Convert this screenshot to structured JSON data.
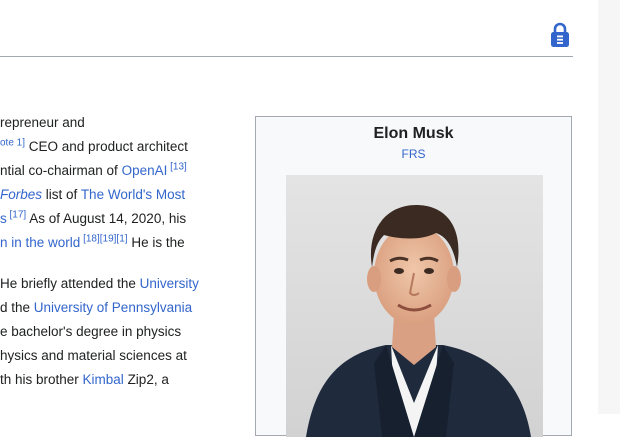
{
  "article": {
    "lines": [
      {
        "parts": [
          {
            "t": "repreneur and",
            "link": false
          }
        ]
      },
      {
        "parts": [
          {
            "t": "ote 1]",
            "cite": true
          },
          {
            "t": " CEO and product architect",
            "link": false
          }
        ]
      },
      {
        "parts": [
          {
            "t": "ntial co-chairman of ",
            "link": false
          },
          {
            "t": "OpenAI",
            "link": true
          },
          {
            "t": " [13]",
            "cite": true
          }
        ]
      },
      {
        "parts": [
          {
            "t": "Forbes",
            "link": true,
            "italic": true
          },
          {
            "t": " list of ",
            "link": false
          },
          {
            "t": "The World's Most",
            "link": true
          }
        ]
      },
      {
        "parts": [
          {
            "t": "s",
            "link": true
          },
          {
            "t": " [17]",
            "cite": true
          },
          {
            "t": " As of August 14, 2020, his",
            "link": false
          }
        ]
      },
      {
        "parts": [
          {
            "t": "n in the world",
            "link": true
          },
          {
            "t": " [18][19][1]",
            "cite": true
          },
          {
            "t": " He is the",
            "link": false
          }
        ]
      },
      {
        "gap": true
      },
      {
        "parts": [
          {
            "t": "He briefly attended the ",
            "link": false
          },
          {
            "t": "University",
            "link": true
          }
        ]
      },
      {
        "parts": [
          {
            "t": "d the ",
            "link": false
          },
          {
            "t": "University of Pennsylvania",
            "link": true
          }
        ]
      },
      {
        "parts": [
          {
            "t": "e bachelor's degree in physics",
            "link": false
          }
        ]
      },
      {
        "parts": [
          {
            "t": "hysics and material sciences at",
            "link": false
          }
        ]
      },
      {
        "parts": [
          {
            "t": "th his brother ",
            "link": false
          },
          {
            "t": "Kimbal",
            "link": true
          },
          {
            "t": " Zip2, a",
            "link": false
          }
        ]
      }
    ]
  },
  "infobox": {
    "name": "Elon Musk",
    "subtitle": "FRS"
  },
  "icons": {
    "lock": "lock-icon",
    "photo": "portrait-photo"
  },
  "colors": {
    "link": "#3366cc",
    "lock": "#3366cc",
    "infobox_bg": "#f8f9fa",
    "border": "#a2a9b1"
  }
}
